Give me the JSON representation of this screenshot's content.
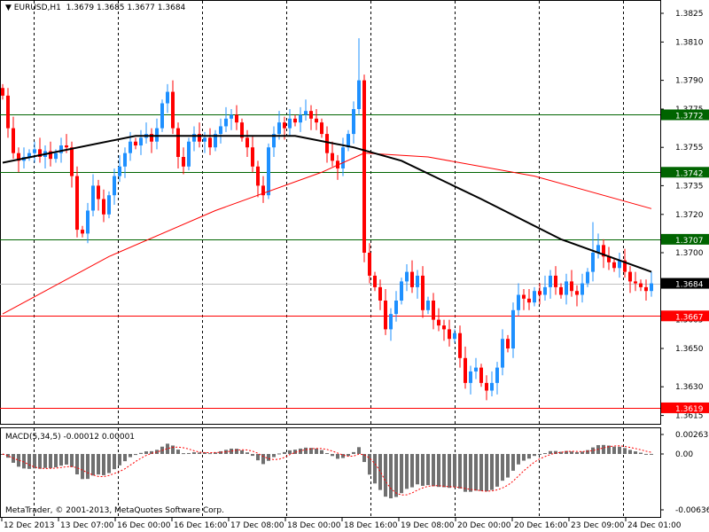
{
  "header": {
    "arrow_icon": "triangle-down",
    "symbol": "EURUSD,H1",
    "open": "1.3679",
    "high": "1.3685",
    "low": "1.3677",
    "close": "1.3684"
  },
  "macd_label": "MACD(5,34,5) -0.00012 0.00001",
  "copyright": "MetaTrader, © 2001-2013, MetaQuotes Software Corp.",
  "colors": {
    "bull": "#1e90ff",
    "bear": "#ff0000",
    "ma_fast": "#000000",
    "ma_slow": "#ff0000",
    "support": "#ff0000",
    "resistance": "#006400",
    "current": "#c0c0c0"
  },
  "chart_data": {
    "type": "candlestick",
    "title": "EURUSD,H1",
    "ylim": [
      1.3612,
      1.3832
    ],
    "price_ticks": [
      "1.3825",
      "1.3810",
      "1.3790",
      "1.3775",
      "1.3755",
      "1.3735",
      "1.3720",
      "1.3700",
      "1.3685",
      "1.3665",
      "1.3650",
      "1.3630",
      "1.3615"
    ],
    "time_labels": [
      "12 Dec 2013",
      "13 Dec 07:00",
      "16 Dec 00:00",
      "16 Dec 16:00",
      "17 Dec 08:00",
      "18 Dec 00:00",
      "18 Dec 16:00",
      "19 Dec 08:00",
      "20 Dec 00:00",
      "20 Dec 16:00",
      "23 Dec 09:00",
      "24 Dec 01:00"
    ],
    "closes": [
      1.3782,
      1.3765,
      1.3752,
      1.3748,
      1.375,
      1.3752,
      1.3754,
      1.375,
      1.3753,
      1.3749,
      1.3752,
      1.3756,
      1.3755,
      1.374,
      1.3712,
      1.371,
      1.3722,
      1.3735,
      1.3728,
      1.372,
      1.373,
      1.374,
      1.3745,
      1.3752,
      1.3758,
      1.3756,
      1.376,
      1.3762,
      1.3758,
      1.3765,
      1.3778,
      1.3784,
      1.3765,
      1.375,
      1.3745,
      1.3758,
      1.3762,
      1.3758,
      1.376,
      1.3755,
      1.3762,
      1.3766,
      1.377,
      1.3772,
      1.3768,
      1.376,
      1.3755,
      1.3745,
      1.3735,
      1.373,
      1.3755,
      1.3762,
      1.3768,
      1.3765,
      1.377,
      1.3768,
      1.3772,
      1.3774,
      1.377,
      1.3768,
      1.3762,
      1.3752,
      1.3748,
      1.3744,
      1.3755,
      1.3762,
      1.3775,
      1.379,
      1.37,
      1.3688,
      1.3682,
      1.3675,
      1.366,
      1.3668,
      1.3675,
      1.3685,
      1.369,
      1.3682,
      1.3688,
      1.367,
      1.3675,
      1.3665,
      1.3662,
      1.366,
      1.3655,
      1.3658,
      1.3645,
      1.3632,
      1.3638,
      1.364,
      1.3632,
      1.3628,
      1.3632,
      1.364,
      1.3655,
      1.365,
      1.367,
      1.3678,
      1.3676,
      1.3674,
      1.368,
      1.3678,
      1.3682,
      1.3688,
      1.3682,
      1.3678,
      1.3685,
      1.368,
      1.3678,
      1.3684,
      1.369,
      1.37,
      1.3704,
      1.3698,
      1.3695,
      1.3692,
      1.3696,
      1.369,
      1.3685,
      1.3684,
      1.3682,
      1.368,
      1.3684
    ],
    "ma_fast": [
      [
        0,
        1.3747
      ],
      [
        25,
        1.3761
      ],
      [
        55,
        1.3761
      ],
      [
        66,
        1.3755
      ],
      [
        75,
        1.3748
      ],
      [
        90,
        1.3728
      ],
      [
        105,
        1.3707
      ],
      [
        122,
        1.369
      ]
    ],
    "ma_slow": [
      [
        0,
        1.3668
      ],
      [
        20,
        1.3698
      ],
      [
        40,
        1.3722
      ],
      [
        60,
        1.3742
      ],
      [
        68,
        1.3752
      ],
      [
        80,
        1.375
      ],
      [
        100,
        1.374
      ],
      [
        122,
        1.3723
      ]
    ],
    "levels": [
      {
        "price": "1.3772",
        "kind": "resistance"
      },
      {
        "price": "1.3742",
        "kind": "resistance"
      },
      {
        "price": "1.3707",
        "kind": "resistance"
      },
      {
        "price": "1.3684",
        "kind": "current"
      },
      {
        "price": "1.3667",
        "kind": "support"
      },
      {
        "price": "1.3619",
        "kind": "support"
      }
    ],
    "macd": {
      "fast": 5,
      "slow": 34,
      "signal": 5,
      "ticks": [
        "0.00263",
        "0.00",
        "-0.00636"
      ],
      "ylim": [
        -0.00636,
        0.00263
      ]
    }
  }
}
